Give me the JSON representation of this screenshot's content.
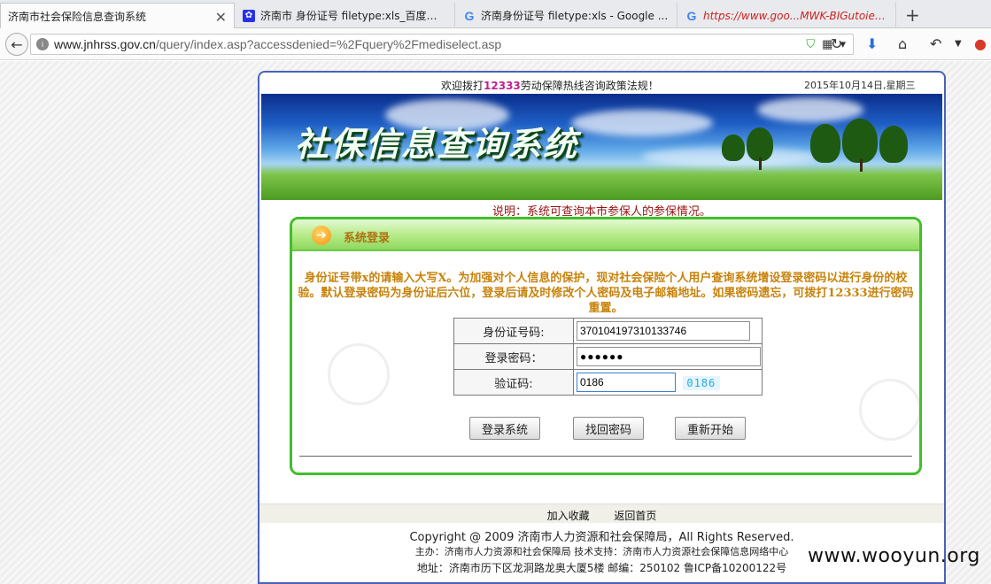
{
  "browser": {
    "tabs": [
      {
        "title": "济南市社会保险信息查询系统",
        "active": true,
        "icon": "page-icon"
      },
      {
        "title": "济南市 身份证号 filetype:xls_百度搜索",
        "icon": "baidu-paw-icon"
      },
      {
        "title": "济南身份证号 filetype:xls - Google ...",
        "icon": "google-icon"
      },
      {
        "title": "https://www.goo...MWK-BIGutoie_w",
        "icon": "google-icon"
      }
    ],
    "close_glyph": "✕",
    "new_tab_glyph": "+",
    "address": {
      "host": "www.jnhrss.gov.cn",
      "path": "/query/index.asp?accessdenied=%2Fquery%2Fmediselect.asp"
    }
  },
  "site": {
    "welcome_prefix": "欢迎拨打",
    "hotline": "12333",
    "welcome_suffix": "劳动保障热线咨询政策法规！",
    "date": "2015年10月14日,星期三",
    "banner_title": "社保信息查询系统",
    "note": "说明：系统可查询本市参保人的参保情况。",
    "login": {
      "title": "系统登录",
      "intro": "身份证号带x的请输入大写X。为加强对个人信息的保护，现对社会保险个人用户查询系统增设登录密码以进行身份的校验。默认登录密码为身份证后六位，登录后请及时修改个人密码及电子邮箱地址。如果密码遗忘，可拨打12333进行密码重置。",
      "fields": {
        "id_label": "身份证号码:",
        "id_value": "370104197310133746",
        "pwd_label": "登录密码：",
        "pwd_value": "●●●●●●",
        "captcha_label": "验证码:",
        "captcha_value": "0186",
        "captcha_image_text": "0186"
      },
      "buttons": {
        "login": "登录系统",
        "recover": "找回密码",
        "restart": "重新开始"
      }
    },
    "footer": {
      "add_fav": "加入收藏",
      "home": "返回首页",
      "copyright": "Copyright @ 2009 济南市人力资源和社会保障局，All Rights Reserved.",
      "sponsor": "主办：济南市人力资源和社会保障局     技术支持：济南市人力资源社会保障信息网络中心",
      "address": "地址：济南市历下区龙洞路龙奥大厦5楼     邮编：250102     鲁ICP备10200122号"
    }
  },
  "watermark": "www.wooyun.org",
  "colors": {
    "accent_blue": "#4a62b8",
    "panel_green": "#3fc02a",
    "intro_orange": "#c8820a",
    "note_red": "#9a1212",
    "hotline_magenta": "#c02090"
  }
}
